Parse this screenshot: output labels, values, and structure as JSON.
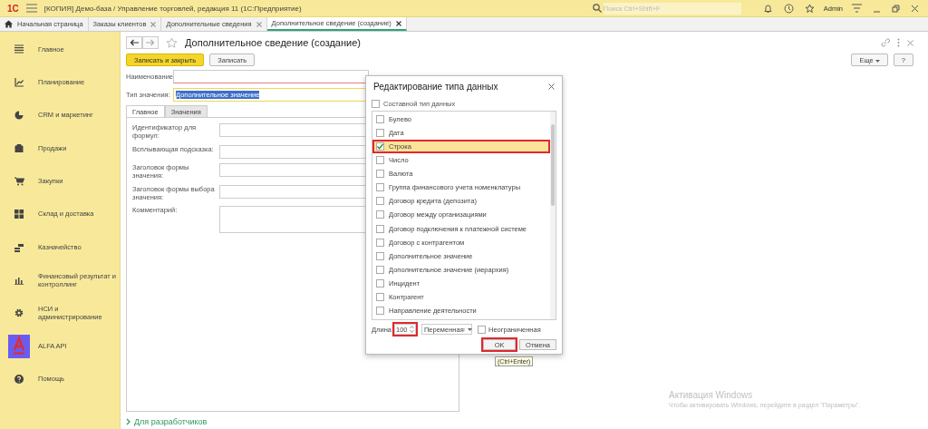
{
  "top_bar": {
    "logo": "1С",
    "title": "[КОПИЯ] Демо-база / Управление торговлей, редакция 11  (1С:Предприятие)",
    "search": {
      "placeholder": "Поиск Ctrl+Shift+F"
    },
    "user": "Admin"
  },
  "tabs": [
    {
      "label": "Начальная страница",
      "kind": "home",
      "selected": false
    },
    {
      "label": "Заказы клиентов",
      "kind": "doc",
      "selected": false
    },
    {
      "label": "Дополнительные сведения",
      "kind": "doc",
      "selected": false
    },
    {
      "label": "Дополнительное сведение (создание)",
      "kind": "doc",
      "selected": true
    }
  ],
  "sidebar": {
    "items": [
      {
        "label": "Главное"
      },
      {
        "label": "Планирование"
      },
      {
        "label": "CRM и маркетинг"
      },
      {
        "label": "Продажи"
      },
      {
        "label": "Закупки"
      },
      {
        "label": "Склад и доставка"
      },
      {
        "label": "Казначейство"
      },
      {
        "label": "Финансовый результат и контроллинг"
      },
      {
        "label": "НСИ и администрирование"
      },
      {
        "label": "ALFA API"
      },
      {
        "label": "Помощь"
      }
    ]
  },
  "form": {
    "title": "Дополнительное сведение (создание)",
    "buttons": [
      {
        "label": "Записать и закрыть",
        "kind": "primary"
      },
      {
        "label": "Записать",
        "kind": "plain"
      }
    ],
    "more_button": "Еще",
    "help_button": "?",
    "fields": [
      {
        "label": "Наименование:",
        "invalid": true,
        "selected_text": false
      },
      {
        "label": "Тип значения:",
        "value": "Дополнительное значение",
        "invalid": false,
        "selected_text": true
      }
    ],
    "tabs": [
      {
        "label": "Главное",
        "selected": true
      },
      {
        "label": "Значения",
        "selected": false
      }
    ],
    "tab_fields": [
      {
        "label": "Идентификатор для формул:",
        "kind": "line"
      },
      {
        "label": "Всплывающая подсказка:",
        "kind": "line"
      },
      {
        "label": "Заголовок формы значения:",
        "kind": "line"
      },
      {
        "label": "Заголовок формы выбора значения:",
        "kind": "line"
      },
      {
        "label": "Комментарий:",
        "kind": "area"
      }
    ],
    "developer_link": "Для разработчиков"
  },
  "dialog": {
    "title": "Редактирование типа данных",
    "composite": {
      "label": "Составной тип данных",
      "checked": false
    },
    "types": [
      {
        "label": "Булево",
        "checked": false,
        "highlighted": false
      },
      {
        "label": "Дата",
        "checked": false,
        "highlighted": false
      },
      {
        "label": "Строка",
        "checked": true,
        "highlighted": true
      },
      {
        "label": "Число",
        "checked": false,
        "highlighted": false
      },
      {
        "label": "Валюта",
        "checked": false,
        "highlighted": false
      },
      {
        "label": "Группа финансового учета номенклатуры",
        "checked": false,
        "highlighted": false
      },
      {
        "label": "Договор кредита (депозита)",
        "checked": false,
        "highlighted": false
      },
      {
        "label": "Договор между организациями",
        "checked": false,
        "highlighted": false
      },
      {
        "label": "Договор подключения к платежной системе",
        "checked": false,
        "highlighted": false
      },
      {
        "label": "Договор с контрагентом",
        "checked": false,
        "highlighted": false
      },
      {
        "label": "Дополнительное значение",
        "checked": false,
        "highlighted": false
      },
      {
        "label": "Дополнительное значение (иерархия)",
        "checked": false,
        "highlighted": false
      },
      {
        "label": "Инцидент",
        "checked": false,
        "highlighted": false
      },
      {
        "label": "Контрагент",
        "checked": false,
        "highlighted": false
      },
      {
        "label": "Направление деятельности",
        "checked": false,
        "highlighted": false
      }
    ],
    "length": {
      "label": "Длина",
      "value": "100",
      "highlighted": true
    },
    "length_mode": "Переменная",
    "unlimited": {
      "label": "Неограниченная",
      "checked": false
    },
    "ok": {
      "label": "OK",
      "highlighted": true
    },
    "cancel": "Отмена",
    "tooltip": "(Ctrl+Enter)"
  },
  "activation": {
    "title": "Активация Windows",
    "text": "Чтобы активировать Windows, перейдите в раздел \"Параметры\"."
  }
}
